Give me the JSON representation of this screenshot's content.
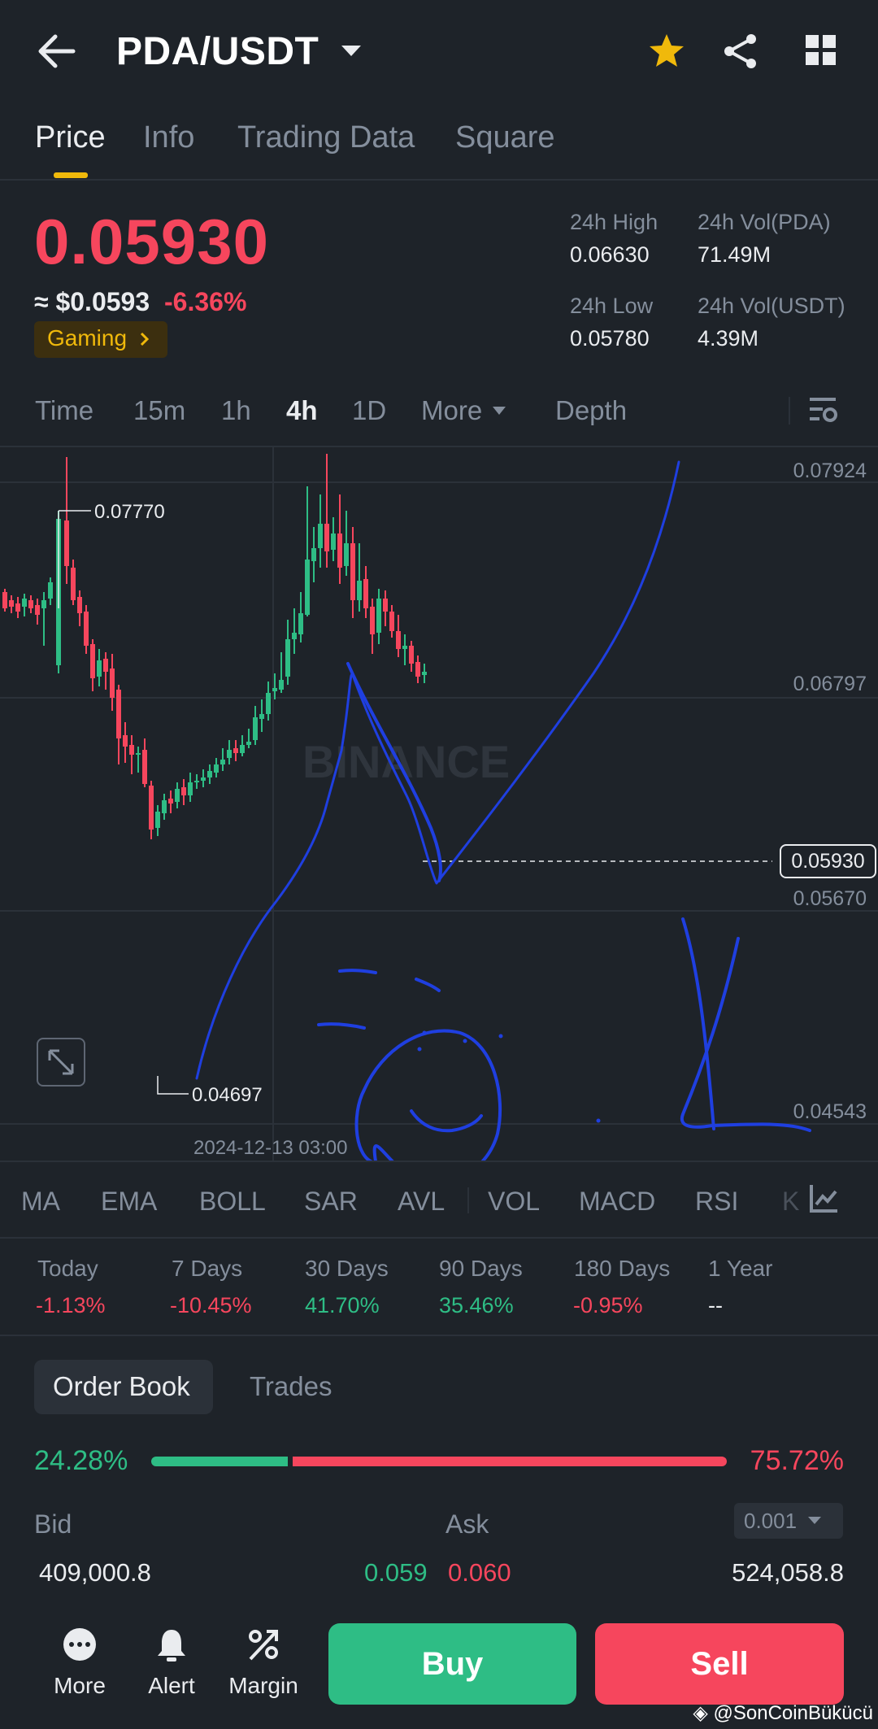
{
  "header": {
    "pair": "PDA/USDT",
    "icons": [
      "back-arrow-icon",
      "chevron-down-icon",
      "star-icon",
      "share-icon",
      "grid-icon"
    ],
    "star_color": "#f0b90b"
  },
  "tabs": [
    {
      "label": "Price",
      "active": true
    },
    {
      "label": "Info"
    },
    {
      "label": "Trading Data"
    },
    {
      "label": "Square"
    }
  ],
  "ticker": {
    "price": "0.05930",
    "approx_usd": "≈ $0.0593",
    "change": "-6.36%",
    "tag": "Gaming",
    "high_label": "24h High",
    "high": "0.06630",
    "low_label": "24h Low",
    "low": "0.05780",
    "vol_pda_label": "24h Vol(PDA)",
    "vol_pda": "71.49M",
    "vol_usdt_label": "24h Vol(USDT)",
    "vol_usdt": "4.39M"
  },
  "intervals": [
    "Time",
    "15m",
    "1h",
    "4h",
    "1D",
    "More",
    "Depth"
  ],
  "active_interval": "4h",
  "chart": {
    "axis_labels": [
      "0.07924",
      "0.06797",
      "0.05670",
      "0.04543"
    ],
    "current_price": "0.05930",
    "max_label": "0.07770",
    "min_label": "0.04697",
    "date_label": "2024-12-13 03:00",
    "watermark": "BINANCE",
    "colors": {
      "up": "#2ebd85",
      "down": "#f6465d",
      "annotation": "#1f3fe0"
    }
  },
  "indicators": [
    "MA",
    "EMA",
    "BOLL",
    "SAR",
    "AVL",
    "VOL",
    "MACD",
    "RSI",
    "K"
  ],
  "performance": [
    {
      "label": "Today",
      "value": "-1.13%",
      "dir": "down"
    },
    {
      "label": "7 Days",
      "value": "-10.45%",
      "dir": "down"
    },
    {
      "label": "30 Days",
      "value": "41.70%",
      "dir": "up"
    },
    {
      "label": "90 Days",
      "value": "35.46%",
      "dir": "up"
    },
    {
      "label": "180 Days",
      "value": "-0.95%",
      "dir": "down"
    },
    {
      "label": "1 Year",
      "value": "--",
      "dir": "flat"
    }
  ],
  "orderbook": {
    "tab_active": "Order Book",
    "tab_other": "Trades",
    "bid_pct": "24.28%",
    "ask_pct": "75.72%",
    "bid_fraction": 0.2428,
    "bid_label": "Bid",
    "ask_label": "Ask",
    "precision": "0.001",
    "bid_qty": "409,000.8",
    "bid_price": "0.059",
    "ask_price": "0.060",
    "ask_qty": "524,058.8"
  },
  "bottom": {
    "more": "More",
    "alert": "Alert",
    "margin": "Margin",
    "buy": "Buy",
    "sell": "Sell",
    "credit": "@SonCoinBükücü"
  }
}
